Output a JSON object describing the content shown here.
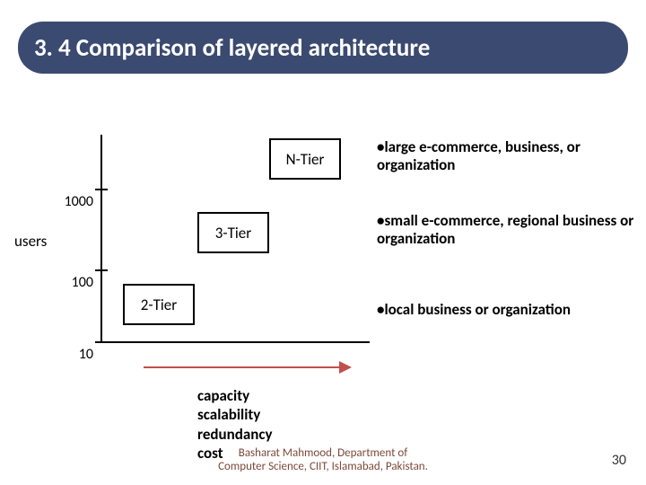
{
  "title": "3. 4 Comparison of layered architecture",
  "axis": {
    "y_label": "users",
    "y_ticks": [
      "1000",
      "100",
      "10"
    ],
    "x_labels": [
      "capacity",
      "scalability",
      "redundancy",
      "cost"
    ]
  },
  "tiers": {
    "n": "N-Tier",
    "t3": "3-Tier",
    "t2": "2-Tier"
  },
  "notes": {
    "n": "large e-commerce, business, or organization",
    "t3": "small e-commerce, regional business or organization",
    "t2": "local business or organization"
  },
  "bullet": "•",
  "footer": {
    "line1": "Basharat Mahmood, Department of",
    "line2": "Computer Science, CIIT, Islamabad, Pakistan."
  },
  "page": "30",
  "chart_data": {
    "type": "table",
    "title": "Layered architecture vs users scale",
    "series": [
      {
        "name": "2-Tier",
        "users": 10,
        "note": "local business or organization"
      },
      {
        "name": "3-Tier",
        "users": 100,
        "note": "small e-commerce, regional business or organization"
      },
      {
        "name": "N-Tier",
        "users": 1000,
        "note": "large e-commerce, business, or organization"
      }
    ],
    "x_dimension": [
      "capacity",
      "scalability",
      "redundancy",
      "cost"
    ],
    "y_label": "users"
  }
}
